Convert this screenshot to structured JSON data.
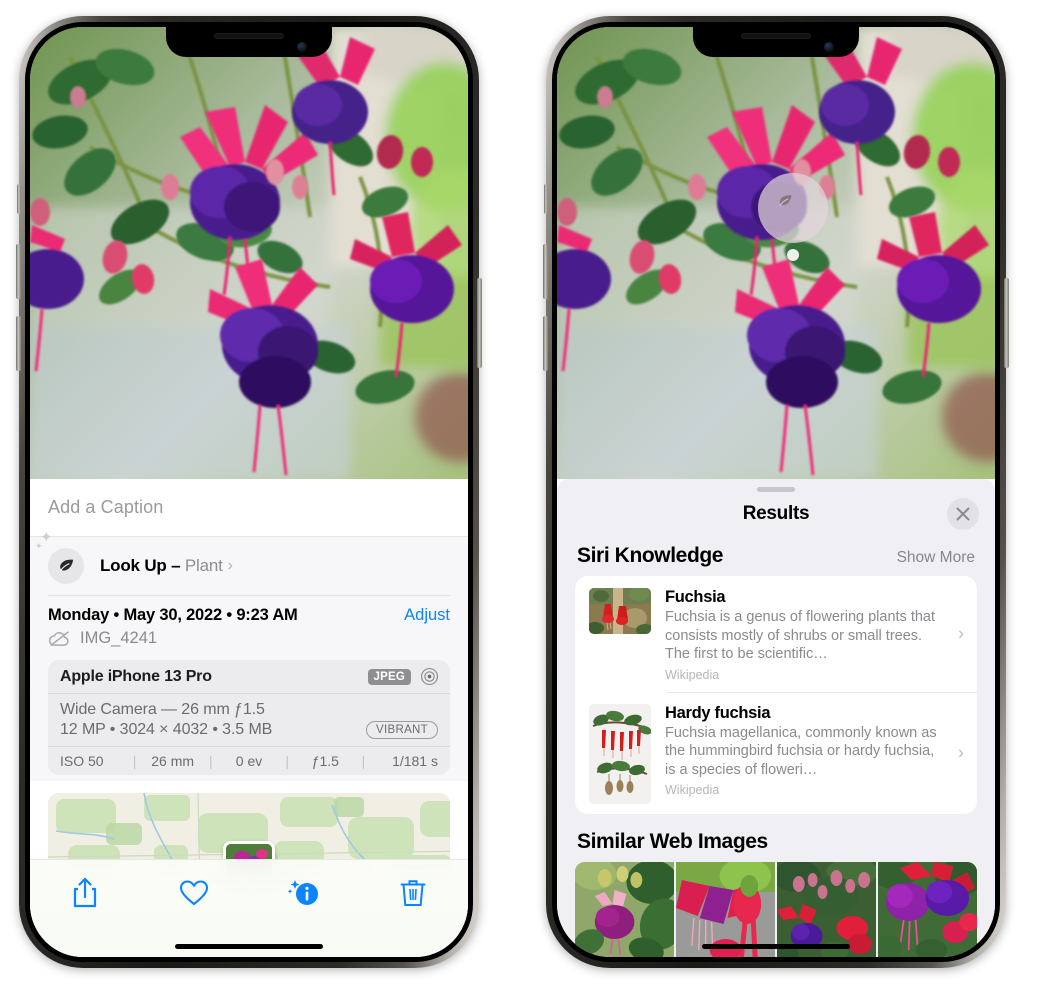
{
  "left_phone": {
    "caption": {
      "placeholder": "Add a Caption",
      "value": ""
    },
    "lookup": {
      "label": "Look Up – ",
      "category": "Plant",
      "icon": "leaf-icon",
      "chevron": "›"
    },
    "date": {
      "text": "Monday • May 30, 2022 • 9:23 AM",
      "adjust_label": "Adjust"
    },
    "file": {
      "name": "IMG_4241",
      "icon": "cloud-slash-icon"
    },
    "camera": {
      "model": "Apple iPhone 13 Pro",
      "format_tag": "JPEG",
      "raw_icon": "aperture-icon",
      "lens": "Wide Camera — 26 mm ƒ1.5",
      "resolution": "12 MP • 3024 × 4032 • 3.5 MB",
      "style_tag": "VIBRANT",
      "exif": [
        "ISO 50",
        "26 mm",
        "0 ev",
        "ƒ1.5",
        "1/181 s"
      ]
    },
    "toolbar": [
      {
        "name": "share-button",
        "icon": "share-icon"
      },
      {
        "name": "favorite-button",
        "icon": "heart-icon"
      },
      {
        "name": "info-button",
        "icon": "info-sparkle-icon"
      },
      {
        "name": "delete-button",
        "icon": "trash-icon"
      }
    ],
    "accent_color": "#0a84ff"
  },
  "right_phone": {
    "photo_badge": {
      "icon": "leaf-icon",
      "name": "visual-lookup-badge"
    },
    "sheet": {
      "title": "Results",
      "close_icon": "close-x-icon",
      "sections": [
        {
          "title": "Siri Knowledge",
          "action": "Show More",
          "items": [
            {
              "title": "Fuchsia",
              "description": "Fuchsia is a genus of flowering plants that consists mostly of shrubs or small trees. The first to be scientific…",
              "source": "Wikipedia"
            },
            {
              "title": "Hardy fuchsia",
              "description": "Fuchsia magellanica, commonly known as the hummingbird fuchsia or hardy fuchsia, is a species of floweri…",
              "source": "Wikipedia"
            }
          ]
        },
        {
          "title": "Similar Web Images",
          "tiles": [
            "web-image-1",
            "web-image-2",
            "web-image-3",
            "web-image-4"
          ]
        }
      ]
    }
  }
}
